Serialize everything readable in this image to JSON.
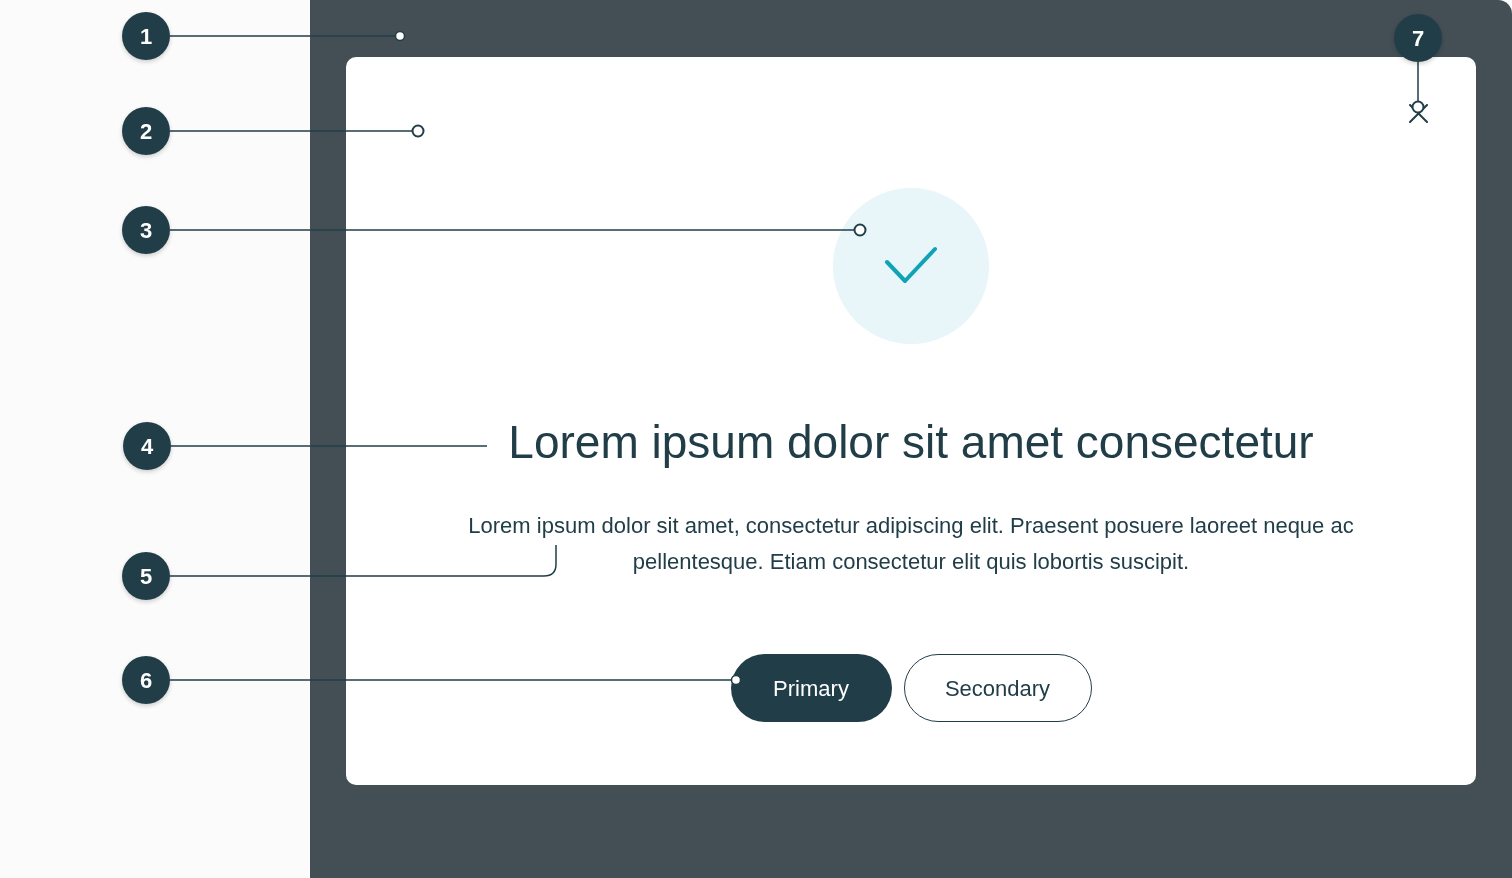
{
  "annotations": [
    {
      "number": "1",
      "kind": "dot"
    },
    {
      "number": "2",
      "kind": "ring"
    },
    {
      "number": "3",
      "kind": "ring"
    },
    {
      "number": "4",
      "kind": "plain"
    },
    {
      "number": "5",
      "kind": "bracket"
    },
    {
      "number": "6",
      "kind": "dot"
    },
    {
      "number": "7",
      "kind": "ring"
    }
  ],
  "dialog": {
    "title": "Lorem ipsum dolor sit amet consectetur",
    "body": "Lorem ipsum dolor sit amet, consectetur adipiscing elit. Praesent posuere laoreet neque ac pellentesque. Etiam consectetur elit quis lobortis suscipit.",
    "buttons": [
      {
        "label": "Primary",
        "kind": "primary"
      },
      {
        "label": "Secondary",
        "kind": "secondary"
      }
    ]
  }
}
